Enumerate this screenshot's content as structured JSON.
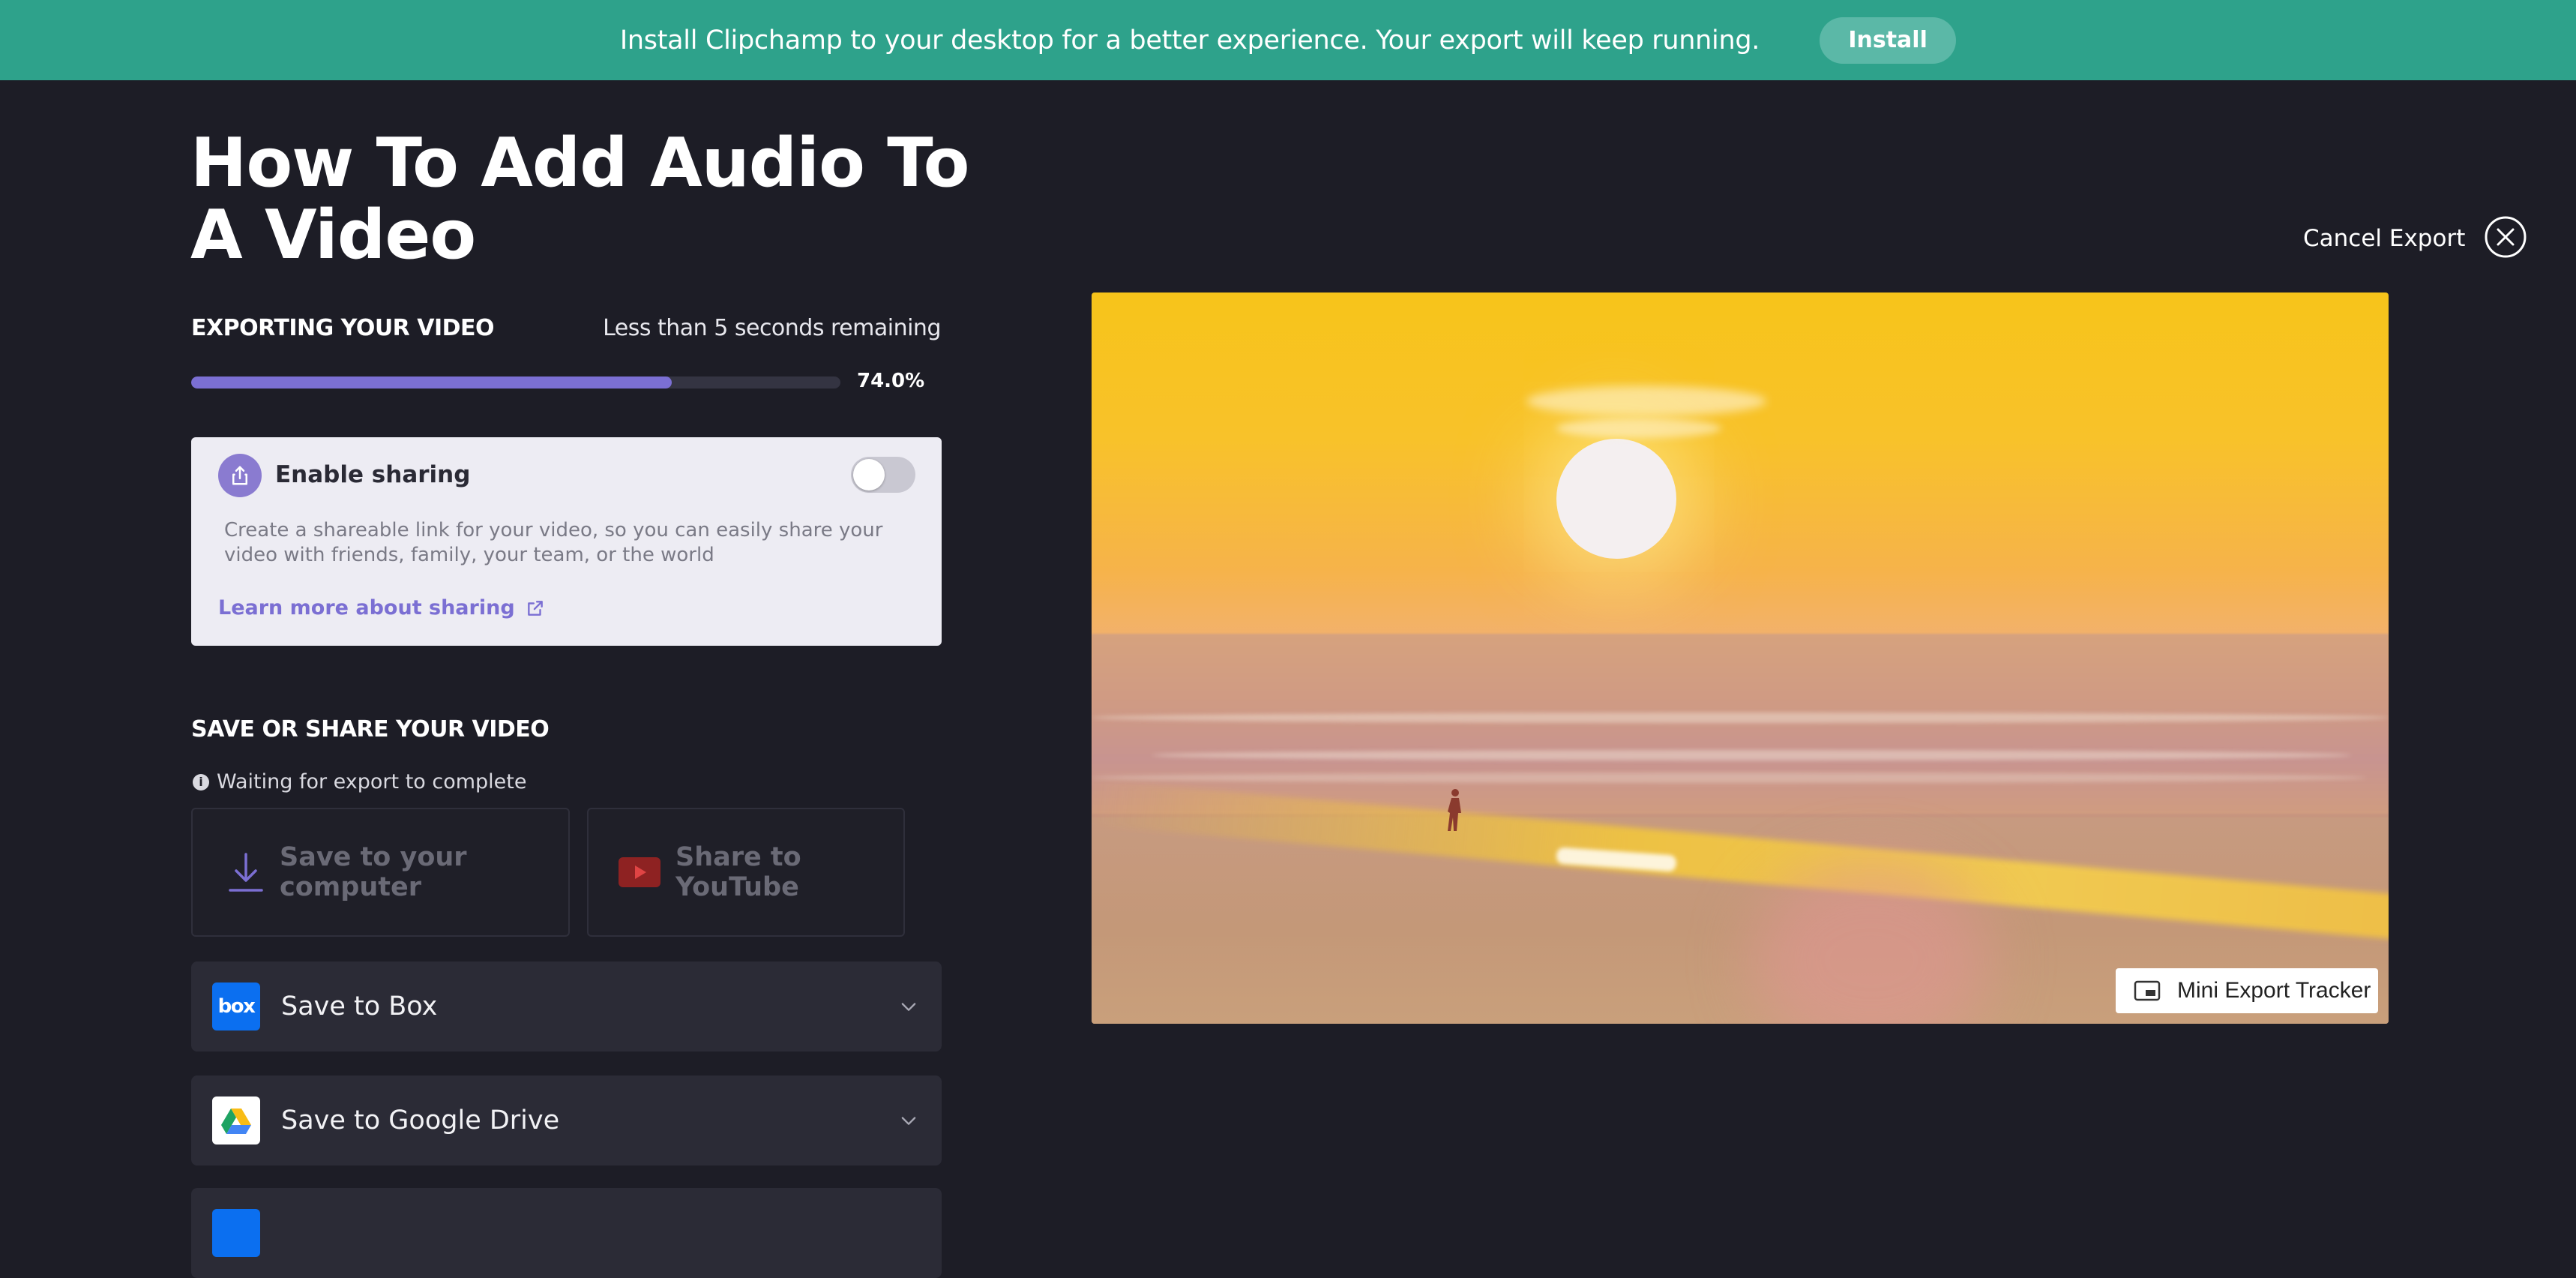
{
  "banner": {
    "message": "Install Clipchamp to your desktop for a better experience. Your export will keep running.",
    "install_label": "Install"
  },
  "project": {
    "title": "How To Add Audio To A Video"
  },
  "export": {
    "label": "EXPORTING YOUR VIDEO",
    "remaining": "Less than 5 seconds remaining",
    "progress_percent": 74.0,
    "progress_text": "74.0%"
  },
  "sharing": {
    "title": "Enable sharing",
    "enabled": false,
    "description": "Create a shareable link for your video, so you can easily share your video with friends, family, your team, or the world",
    "learn_more": "Learn more about sharing"
  },
  "save_section": {
    "title": "SAVE OR SHARE YOUR VIDEO",
    "waiting": "Waiting for export to complete",
    "save_computer": "Save to your computer",
    "share_youtube": "Share to YouTube",
    "destinations": [
      {
        "label": "Save to Box",
        "icon": "box-logo-icon"
      },
      {
        "label": "Save to Google Drive",
        "icon": "google-drive-icon"
      }
    ]
  },
  "header": {
    "cancel_label": "Cancel Export"
  },
  "preview": {
    "mini_tracker_label": "Mini Export Tracker"
  },
  "colors": {
    "banner": "#2ea28b",
    "background": "#1d1d26",
    "accent": "#7b6fd3",
    "box_brand": "#0b6ff0",
    "youtube_red": "#c4302b"
  }
}
